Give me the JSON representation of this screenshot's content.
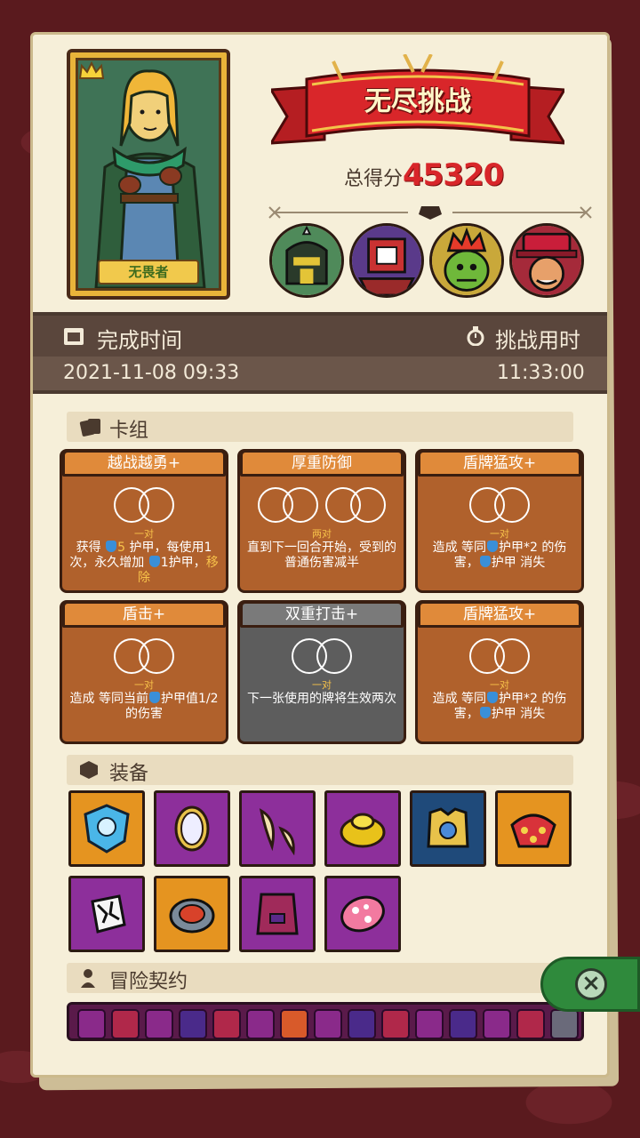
{
  "hero": {
    "name": "无畏者"
  },
  "banner": {
    "title": "无尽挑战"
  },
  "score": {
    "label": "总得分",
    "value": "45320"
  },
  "enemies": [
    {
      "name": "armored-knight",
      "icon": "knight-helmet-icon"
    },
    {
      "name": "drum-robot",
      "icon": "drum-robot-icon"
    },
    {
      "name": "goblin-king",
      "icon": "goblin-king-icon"
    },
    {
      "name": "red-hat-jester",
      "icon": "jester-icon"
    }
  ],
  "time": {
    "complete_label": "完成时间",
    "complete_value": "2021-11-08 09:33",
    "duration_label": "挑战用时",
    "duration_value": "11:33:00"
  },
  "deck": {
    "label": "卡组",
    "cards": [
      {
        "title": "越战越勇+",
        "rings": 1,
        "sub": "一对",
        "desc_a": "获得 ",
        "desc_b": "5",
        "desc_c": " 护甲，每使用1次，永久增加 ",
        "desc_d": "1护甲，",
        "desc_e": "移除",
        "color": "orange"
      },
      {
        "title": "厚重防御",
        "rings": 2,
        "sub": "两对",
        "desc": "直到下一回合开始，受到的普通伤害减半",
        "color": "orange"
      },
      {
        "title": "盾牌猛攻+",
        "rings": 1,
        "sub": "一对",
        "desc_a": "造成 等同",
        "desc_b": "护甲*2 的伤害，",
        "desc_c": "护甲 消失",
        "color": "orange"
      },
      {
        "title": "盾击+",
        "rings": 1,
        "sub": "一对",
        "desc_a": "造成 等同当前",
        "desc_b": "护甲值1/2的伤害",
        "color": "orange"
      },
      {
        "title": "双重打击+",
        "rings": 1,
        "sub": "一对",
        "desc": "下一张使用的牌将生效两次",
        "color": "gray"
      },
      {
        "title": "盾牌猛攻+",
        "rings": 1,
        "sub": "一对",
        "desc_a": "造成 等同",
        "desc_b": "护甲*2 的伤害，",
        "desc_c": "护甲 消失",
        "color": "orange"
      }
    ]
  },
  "equipment": {
    "label": "装备",
    "items": [
      {
        "icon": "ice-shield-icon",
        "rarity": "orange"
      },
      {
        "icon": "mirror-icon",
        "rarity": "purple"
      },
      {
        "icon": "claw-icon",
        "rarity": "purple"
      },
      {
        "icon": "golden-ring-icon",
        "rarity": "purple"
      },
      {
        "icon": "chest-armor-icon",
        "rarity": "blue"
      },
      {
        "icon": "spiked-shell-icon",
        "rarity": "orange"
      },
      {
        "icon": "shattered-cube-icon",
        "rarity": "purple"
      },
      {
        "icon": "fire-disc-icon",
        "rarity": "orange"
      },
      {
        "icon": "cape-armor-icon",
        "rarity": "purple"
      },
      {
        "icon": "mushroom-cap-icon",
        "rarity": "purple"
      }
    ]
  },
  "contract": {
    "label": "冒险契约"
  },
  "colors": {
    "score": "#d8262a",
    "card_orange": "#b0612c",
    "card_gray": "#5d5d5d",
    "close_tab": "#2f8a3c"
  }
}
